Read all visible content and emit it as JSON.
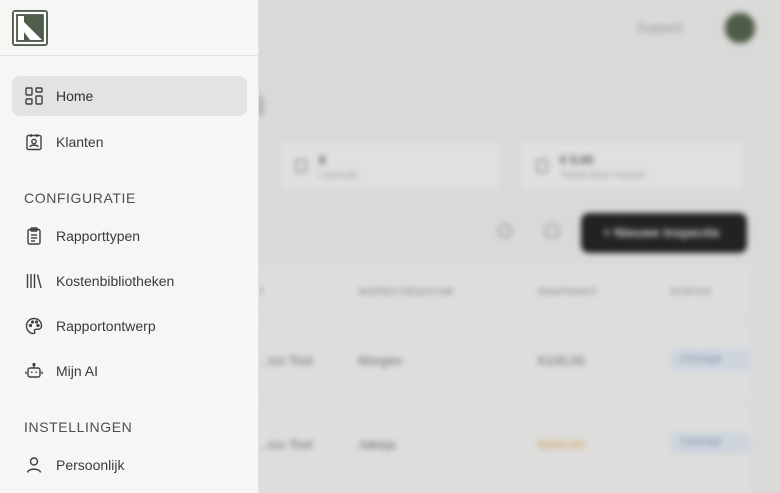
{
  "background": {
    "support_label": "Support",
    "stats": [
      {
        "value": "8",
        "caption": "Lopende"
      },
      {
        "value": "€ 0,00",
        "caption": "Totaal deze maand"
      }
    ],
    "new_button_label": "+ Nieuwe Inspectie",
    "table": {
      "headers": [
        "T",
        "INSPECTIEDATUM",
        "SNAPSHOT",
        "STATUS"
      ],
      "rows": [
        {
          "client": "...ico Tool",
          "date": "Morgen",
          "amount": "€100,00",
          "status": "Concept"
        },
        {
          "client": "...ico Tool",
          "date": "Jakeja",
          "amount": "€600,00",
          "status": "Concept"
        }
      ]
    }
  },
  "sidebar": {
    "nav_main": [
      {
        "label": "Home",
        "icon": "dashboard-grid-icon",
        "active": true
      },
      {
        "label": "Klanten",
        "icon": "contact-card-icon",
        "active": false
      }
    ],
    "section_config": "CONFIGURATIE",
    "nav_config": [
      {
        "label": "Rapporttypen",
        "icon": "clipboard-list-icon"
      },
      {
        "label": "Kostenbibliotheken",
        "icon": "library-icon"
      },
      {
        "label": "Rapportontwerp",
        "icon": "palette-icon"
      },
      {
        "label": "Mijn AI",
        "icon": "robot-icon"
      }
    ],
    "section_settings": "INSTELLINGEN",
    "nav_settings": [
      {
        "label": "Persoonlijk",
        "icon": "user-icon"
      }
    ]
  },
  "colors": {
    "brand": "#4f5d4a",
    "active_bg": "#e3e4e1",
    "sidebar_bg": "#f6f6f5"
  }
}
